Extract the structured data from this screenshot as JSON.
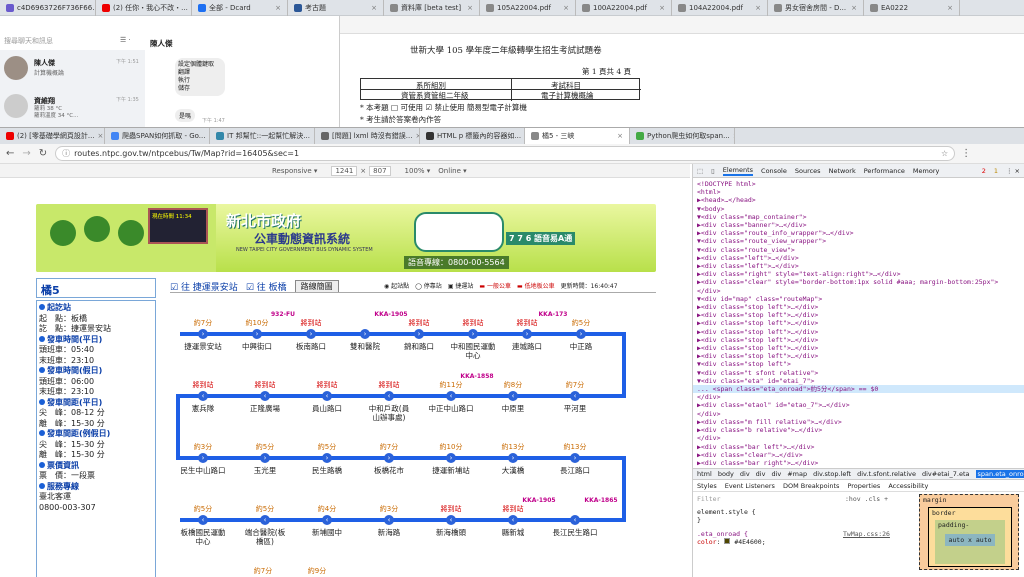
{
  "outer_tabs": [
    {
      "label": "c4D6963726F736F66...",
      "color": "#6a5acd"
    },
    {
      "label": "(2) 任你・我心不改・...",
      "color": "#e00"
    },
    {
      "label": "全部 - Dcard",
      "color": "#1d6ff2"
    },
    {
      "label": "考古題",
      "color": "#2b5797"
    },
    {
      "label": "資料庫 [beta test]",
      "color": "#888"
    },
    {
      "label": "105A22004.pdf",
      "color": "#888"
    },
    {
      "label": "100A22004.pdf",
      "color": "#888"
    },
    {
      "label": "104A22004.pdf",
      "color": "#888"
    },
    {
      "label": "男女宿舍房間 - D...",
      "color": "#888"
    },
    {
      "label": "EA0222",
      "color": "#888"
    }
  ],
  "chat": {
    "search_placeholder": "搜尋聊天和訊息",
    "contacts": [
      {
        "name": "陳人傑",
        "preview": "計算機概論",
        "time": "下午 1:51"
      },
      {
        "name": "資維翔",
        "preview": "蘿莉 38 °C\n蘿莉溫度 34 °C...",
        "time": "下午 1:35"
      }
    ],
    "conv_name": "陳人傑",
    "messages": [
      "設定個體鍵取",
      "翻譯",
      "執行",
      "儲存"
    ],
    "msg2": "是嗎",
    "msg_time1": "下午 1:51",
    "msg_time2": "下午 1:47"
  },
  "pdf": {
    "title": "世新大學 105 學年度二年級轉學生招生考試試題卷",
    "page_info": "第 1 頁共 4 頁",
    "dept_label": "系所組別",
    "subject_label": "考試科目",
    "dept": "資管系資管組二年級",
    "subject": "電子計算機概論",
    "note1": "* 本考題 □ 可使用 ☑ 禁止使用 簡易型電子計算機",
    "note2": "* 考生請於答案卷內作答"
  },
  "inner_tabs": [
    {
      "label": "(2) [零基礎學網頁設計...",
      "color": "#e00"
    },
    {
      "label": "爬蟲SPAN如何抓取 - Go...",
      "color": "#4285f4"
    },
    {
      "label": "IT 邦幫忙::一起幫忙解決...",
      "color": "#38a"
    },
    {
      "label": "[問題] lxml 時沒有錯誤...",
      "color": "#666"
    },
    {
      "label": "HTML p 標籤內的容器如...",
      "color": "#333"
    },
    {
      "label": "橘5 - 三峽",
      "color": "#888"
    },
    {
      "label": "Python爬虫如何取span...",
      "color": "#4a4"
    }
  ],
  "url": "routes.ntpc.gov.tw/ntpcebus/Tw/Map?rid=16405&sec=1",
  "devbar": {
    "mode": "Responsive ▾",
    "w": "1241",
    "h": "807",
    "zoom": "100% ▾",
    "net": "Online ▾"
  },
  "site": {
    "banner_title": "新北市政府",
    "banner_sub": "公車動態資訊系統",
    "banner_en": "NEW TAIPEI CITY GOVERNMENT BUS DYNAMIC SYSTEM",
    "phone": "語音專線：0800-00-5564",
    "voice": "7 7 6 語音易A通",
    "clock": "現在時間 11:34",
    "route": "橘5",
    "dir1": "往 捷運景安站",
    "dir2": "往 板橋",
    "map_btn": "路線簡圖",
    "legend": [
      "起站點",
      "停靠站",
      "捷運站",
      "一般公車",
      "低地板公車"
    ],
    "updated": "更新時間：16:40:47",
    "info": [
      {
        "h": "起訖站",
        "lines": [
          "起　點：板橋",
          "訖　點：捷運景安站"
        ]
      },
      {
        "h": "發車時間(平日)",
        "lines": [
          "頭班車：05:40",
          "末班車：23:10"
        ]
      },
      {
        "h": "發車時間(假日)",
        "lines": [
          "頭班車：06:00",
          "末班車：23:10"
        ]
      },
      {
        "h": "發車間距(平日)",
        "lines": [
          "尖　峰：08-12 分",
          "離　峰：15-30 分"
        ]
      },
      {
        "h": "發車間距(例假日)",
        "lines": [
          "尖　峰：15-30 分",
          "離　峰：15-30 分"
        ]
      },
      {
        "h": "票價資訊",
        "lines": [
          "票　價：一段票"
        ]
      },
      {
        "h": "服務專線",
        "lines": [
          "臺北客運",
          "0800-003-307"
        ]
      }
    ],
    "row1": [
      {
        "eta": "約7分",
        "stop": "捷運景安站",
        "r": false
      },
      {
        "eta": "約10分",
        "stop": "中興街口",
        "r": false,
        "bus": "932-FU"
      },
      {
        "eta": "將到站",
        "stop": "板南路口",
        "r": true
      },
      {
        "eta": "",
        "stop": "雙和醫院",
        "r": false,
        "bus": "KKA-1905"
      },
      {
        "eta": "將到站",
        "stop": "錦和路口",
        "r": true
      },
      {
        "eta": "將到站",
        "stop": "中和國民運動中心",
        "r": true
      },
      {
        "eta": "將到站",
        "stop": "連城路口",
        "r": true,
        "bus": "KKA-173"
      },
      {
        "eta": "約5分",
        "stop": "中正路",
        "r": false
      }
    ],
    "row2": [
      {
        "eta": "將到站",
        "stop": "憲兵隊",
        "r": true
      },
      {
        "eta": "將到站",
        "stop": "正隆廣場",
        "r": true
      },
      {
        "eta": "將到站",
        "stop": "員山路口",
        "r": true
      },
      {
        "eta": "將到站",
        "stop": "中和戶政(員山辦事處)",
        "r": true
      },
      {
        "eta": "約11分",
        "stop": "中正中山路口",
        "r": false,
        "bus": "KKA-1858"
      },
      {
        "eta": "約8分",
        "stop": "中原里",
        "r": false
      },
      {
        "eta": "約7分",
        "stop": "平河里",
        "r": false
      }
    ],
    "row3": [
      {
        "eta": "約3分",
        "stop": "民生中山路口",
        "r": false
      },
      {
        "eta": "約5分",
        "stop": "玉光里",
        "r": false
      },
      {
        "eta": "約5分",
        "stop": "民生路橋",
        "r": false
      },
      {
        "eta": "約7分",
        "stop": "板橋花市",
        "r": false
      },
      {
        "eta": "約10分",
        "stop": "捷運新埔站",
        "r": false
      },
      {
        "eta": "約13分",
        "stop": "大漢橋",
        "r": false
      },
      {
        "eta": "約13分",
        "stop": "長江路口",
        "r": false
      }
    ],
    "row4": [
      {
        "eta": "約5分",
        "stop": "板橋國民運動中心",
        "r": false
      },
      {
        "eta": "約5分",
        "stop": "端合醫院(板橋區)",
        "r": false
      },
      {
        "eta": "約4分",
        "stop": "新埔國中",
        "r": false
      },
      {
        "eta": "約3分",
        "stop": "新海路",
        "r": false
      },
      {
        "eta": "將到站",
        "stop": "新海橋頭",
        "r": true
      },
      {
        "eta": "將到站",
        "stop": "縣新城",
        "r": true,
        "bus": "KKA-1905"
      },
      {
        "eta": "",
        "stop": "長江民生路口",
        "r": false,
        "bus": "KKA-1865"
      }
    ],
    "row5": [
      "約7分",
      "約9分"
    ]
  },
  "devtools": {
    "tabs": [
      "Elements",
      "Console",
      "Sources",
      "Network",
      "Performance",
      "Memory"
    ],
    "errors": "2",
    "warns": "1",
    "dom": [
      "<!DOCTYPE html>",
      "<html>",
      "▶<head>…</head>",
      "▼<body>",
      "  ▼<div class=\"map_container\">",
      "    ▶<div class=\"banner\">…</div>",
      "    ▶<div class=\"route_info_wrapper\">…</div>",
      "    ▼<div class=\"route_view_wrapper\">",
      "      ▼<div class=\"route_view\">",
      "        ▶<div class=\"left\">…</div>",
      "        ▶<div class=\"left\">…</div>",
      "        ▶<div class=\"right\" style=\"text-align:right\">…</div>",
      "        ▶<div class=\"clear\" style=\"border-bottom:1px solid #aaa; margin-bottom:25px\">",
      "      </div>",
      "    ▼<div id=\"map\" class=\"routeMap\">",
      "      ▶<div class=\"stop left\">…</div>",
      "      ▶<div class=\"stop left\">…</div>",
      "      ▶<div class=\"stop left\">…</div>",
      "      ▶<div class=\"stop left\">…</div>",
      "      ▶<div class=\"stop left\">…</div>",
      "      ▶<div class=\"stop left\">…</div>",
      "      ▶<div class=\"stop left\">…</div>",
      "      ▼<div class=\"stop left\">",
      "        ▼<div class=\"t sfont relative\">",
      "          ▼<div class=\"eta\" id=\"etai_7\">",
      "...         <span class=\"eta_onroad\">約5分</span> == $0",
      "            </div>",
      "          ▶<div class=\"etaol\" id=\"etao_7\">…</div>",
      "          </div>",
      "        ▶<div class=\"m fill relative\">…</div>",
      "        ▶<div class=\"b relative\">…</div>",
      "        </div>",
      "      ▶<div class=\"bar left\">…</div>",
      "      ▶<div class=\"clear\">…</div>",
      "      ▶<div class=\"bar right\">…</div>",
      "      ▶<div class=\"stop right\">…</div>",
      "      ▶<div class=\"stop right\">…</div>",
      "      ▶<div class=\"stop right\">…</div>",
      "      ▶<div class=\"stop right\">…</div>",
      "      ▶<div class=\"stop right\">…</div>"
    ],
    "breadcrumbs": [
      "html",
      "body",
      "div",
      "div",
      "div",
      "#map",
      "div.stop.left",
      "div.t.sfont.relative",
      "div#etai_7.eta",
      "span.eta_onroad"
    ],
    "sub_tabs": [
      "Styles",
      "Event Listeners",
      "DOM Breakpoints",
      "Properties",
      "Accessibility"
    ],
    "filter": "Filter",
    "filter_opts": ":hov .cls +",
    "style1": "element.style {",
    "style2": "}",
    "style3": ".eta_onroad {",
    "style4": "  color: #4E4600;",
    "style_src": "TwMap.css:26",
    "box": [
      "margin",
      "border",
      "padding-",
      "auto x auto"
    ]
  }
}
